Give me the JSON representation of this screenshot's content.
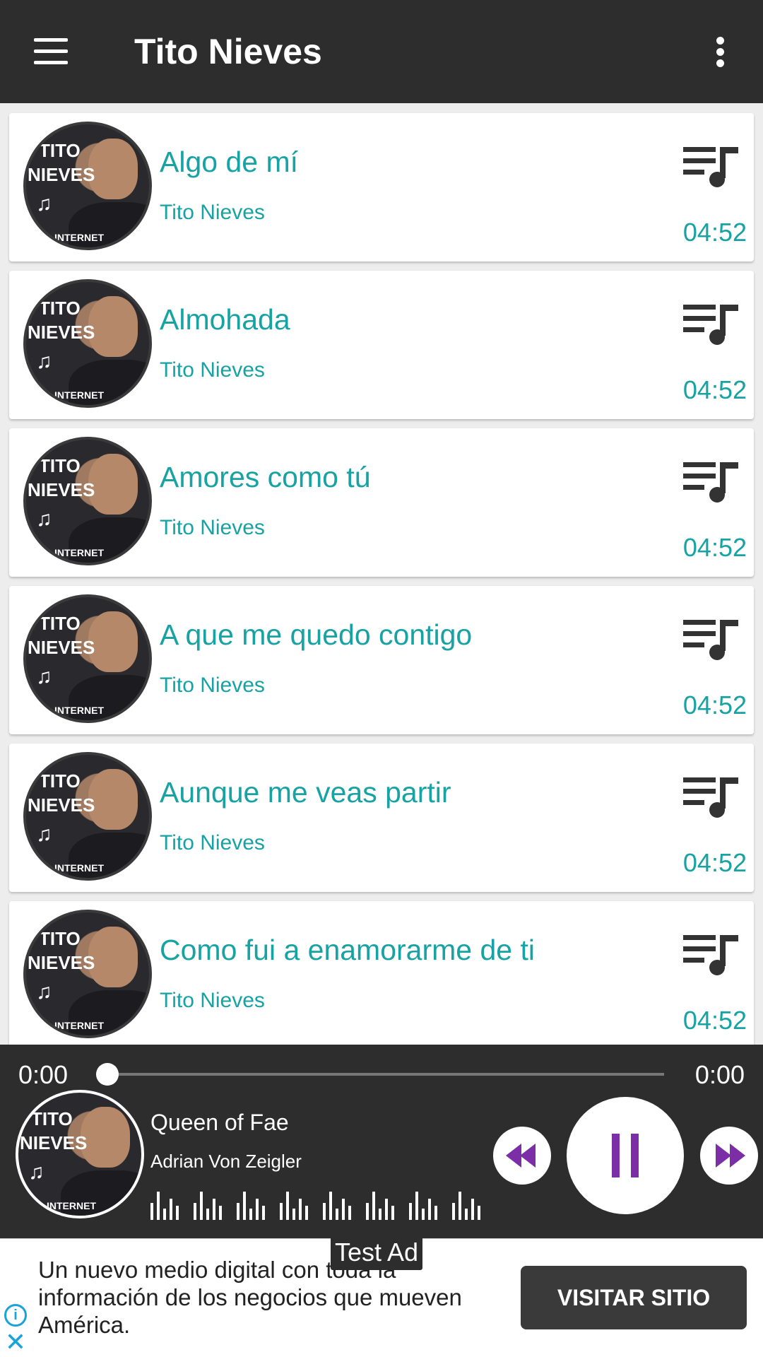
{
  "app_bar": {
    "title": "Tito Nieves",
    "menu_icon": "hamburger-menu-icon",
    "more_icon": "more-vertical-icon"
  },
  "cover": {
    "line1": "TITO",
    "line2": "NIEVES",
    "line3": "INTERNET",
    "note": "♫"
  },
  "songs": [
    {
      "title": "Algo de mí",
      "artist": "Tito Nieves",
      "duration": "04:52"
    },
    {
      "title": "Almohada",
      "artist": "Tito Nieves",
      "duration": "04:52"
    },
    {
      "title": "Amores como tú",
      "artist": "Tito Nieves",
      "duration": "04:52"
    },
    {
      "title": "A que me quedo contigo",
      "artist": "Tito Nieves",
      "duration": "04:52"
    },
    {
      "title": "Aunque me veas partir",
      "artist": "Tito Nieves",
      "duration": "04:52"
    },
    {
      "title": "Como fui a enamorarme de ti",
      "artist": "Tito Nieves",
      "duration": "04:52"
    }
  ],
  "player": {
    "current_time": "0:00",
    "total_time": "0:00",
    "progress": 0,
    "title": "Queen of Fae",
    "artist": "Adrian Von Zeigler",
    "state": "playing"
  },
  "ad": {
    "label": "Test Ad",
    "text": "Un nuevo medio digital con toda la información de los negocios que mueven América.",
    "cta": "VISITAR SITIO"
  },
  "colors": {
    "app_bar": "#2d2d2d",
    "accent_teal": "#17a2a4",
    "player_purple": "#7b2ea6",
    "ad_info_blue": "#1aa3d9"
  }
}
